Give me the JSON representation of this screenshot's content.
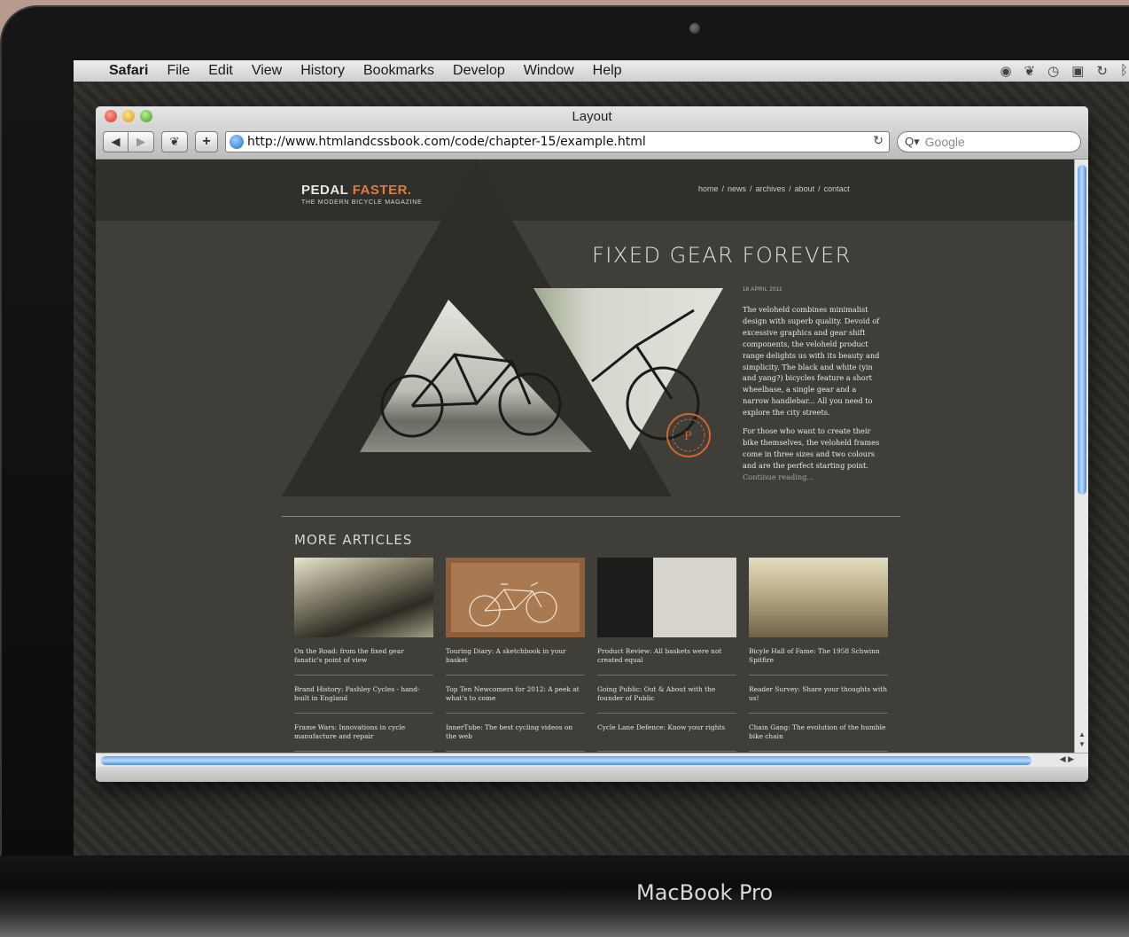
{
  "menubar": {
    "app": "Safari",
    "items": [
      "File",
      "Edit",
      "View",
      "History",
      "Bookmarks",
      "Develop",
      "Window",
      "Help"
    ]
  },
  "browser": {
    "title": "Layout",
    "url": "http://www.htmlandcssbook.com/code/chapter-15/example.html",
    "search_placeholder": "Google"
  },
  "site": {
    "logo_part1": "PEDAL ",
    "logo_part2": "FASTER.",
    "tagline": "THE MODERN BICYCLE MAGAZINE",
    "nav": [
      "home",
      "news",
      "archives",
      "about",
      "contact"
    ]
  },
  "hero": {
    "title": "FIXED GEAR FOREVER",
    "date": "16 APRIL 2011",
    "paragraph1": "The veloheld combines minimalist design with superb quality. Devoid of excessive graphics and gear shift components, the veloheld product range delights us with its beauty and simplicity. The black and white (yin and yang?) bicycles feature a short wheelbase, a single gear and a narrow handlebar... All you need to explore the city streets.",
    "paragraph2": "For those who want to create their bike themselves, the veloheld frames come in three sizes and two colours and are the perfect starting point.",
    "link": "Continue reading..."
  },
  "more": {
    "title": "MORE ARTICLES",
    "columns": [
      [
        "On the Road: from the fixed gear fanatic's point of view",
        "Brand History: Pashley Cycles - hand-built in England",
        "Frame Wars: Innovations in cycle manufacture and repair"
      ],
      [
        "Touring Diary: A sketchbook in your basket",
        "Top Ten Newcomers for 2012: A peek at what's to come",
        "InnerTube: The best cycling videos on the web"
      ],
      [
        "Product Review: All baskets were not created equal",
        "Going Public: Out & About with the founder of Public",
        "Cycle Lane Defence: Know your rights"
      ],
      [
        "Bicyle Hall of Fame: The 1958 Schwinn Spitfire",
        "Reader Survey: Share your thoughts with us!",
        "Chain Gang: The evolution of the humble bike chain"
      ]
    ]
  },
  "device": {
    "brand": "MacBook Pro"
  },
  "colors": {
    "accent_orange": "#e07a3d",
    "page_bg": "#3f3e39",
    "header_bg": "#2f2f2b",
    "scroll_blue": "#6aa6e6"
  },
  "icons": [
    "apple-icon",
    "back-arrow-icon",
    "forward-arrow-icon",
    "evernote-icon",
    "add-bookmark-icon",
    "globe-icon",
    "reload-icon",
    "search-icon",
    "magnifier-icon",
    "wifi-icon",
    "time-machine-icon",
    "display-icon",
    "sync-icon",
    "bluetooth-icon"
  ]
}
